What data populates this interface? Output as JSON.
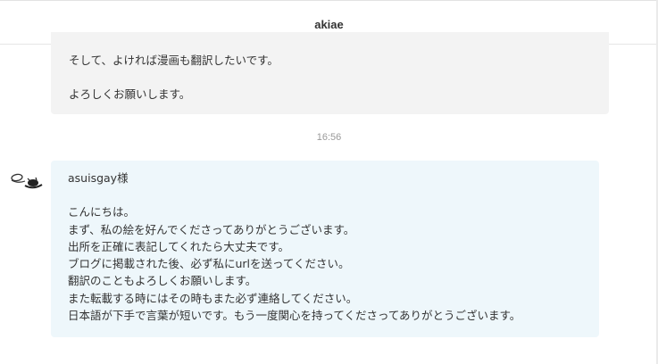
{
  "header": {
    "title": "akiae"
  },
  "messages": [
    {
      "lines": [
        "そして、よければ漫画も翻訳したいです。",
        "よろしくお願いします。"
      ]
    },
    {
      "timestamp": "16:56",
      "avatar_icon": "doodle-avatar-icon",
      "greeting": "asuisgay様",
      "lines": [
        "こんにちは。",
        "まず、私の絵を好んでくださってありがとうございます。",
        "出所を正確に表記してくれたら大丈夫です。",
        "ブログに掲載された後、必ず私にurlを送ってください。",
        "翻訳のこともよろしくお願いします。",
        "また転載する時にはその時もまた必ず連絡してください。",
        "日本語が下手で言葉が短いです。もう一度関心を持ってくださってありがとうございます。"
      ]
    }
  ],
  "colors": {
    "sent_bubble": "#f3f3f3",
    "received_bubble": "#eef7fb",
    "timestamp": "#999999"
  }
}
